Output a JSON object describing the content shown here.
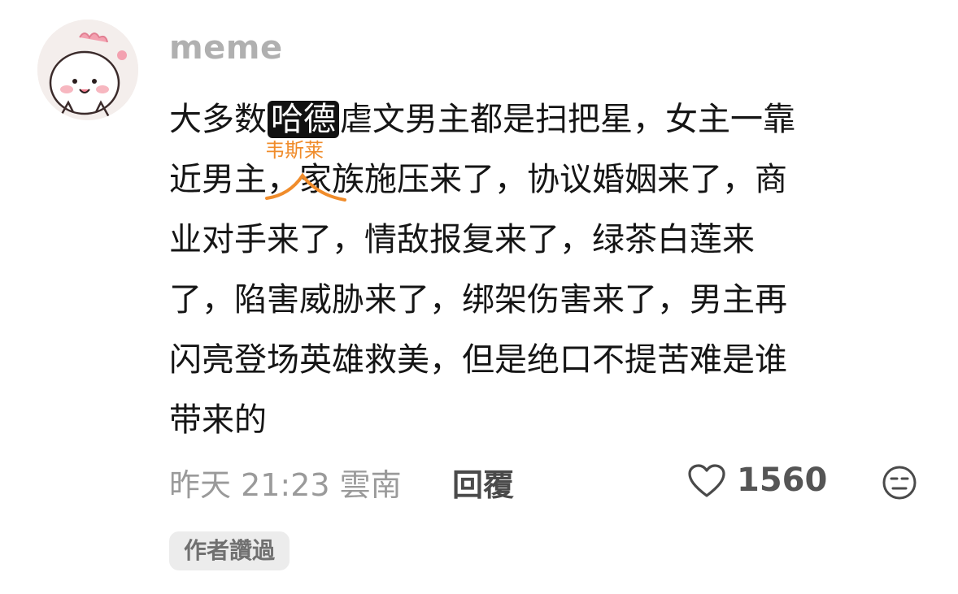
{
  "comment": {
    "username": "meme",
    "lines": [
      {
        "before": "大多数",
        "highlight": "哈德",
        "after": "虐文男主都是扫把星，女主一靠"
      },
      {
        "text": "近男主，家族施压来了，协议婚姻来了，商"
      },
      {
        "text": "业对手来了，情敌报复来了，绿茶白莲来"
      },
      {
        "text": "了，陷害威胁来了，绑架伤害来了，男主再"
      },
      {
        "text": "闪亮登场英雄救美，但是绝口不提苦难是谁"
      },
      {
        "text": "带来的"
      }
    ],
    "annotation": "韦斯莱",
    "timestamp": "昨天 21:23 雲南",
    "reply_label": "回覆",
    "like_count": "1560",
    "author_badge": "作者讚過"
  },
  "colors": {
    "annotation": "#f08c2b",
    "highlight_bg": "#111111",
    "username": "#b0b0b0",
    "meta": "#9a9a9a"
  },
  "icons": {
    "avatar": "cartoon-character-avatar",
    "like": "heart-outline-icon",
    "reaction": "neutral-face-emoji-icon"
  }
}
